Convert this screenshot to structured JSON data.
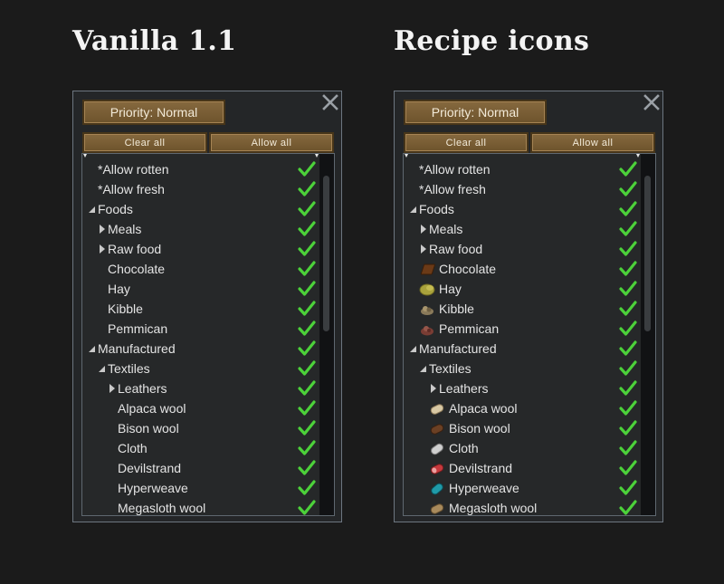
{
  "left": {
    "heading": "Vanilla 1.1",
    "priority_label": "Priority: Normal",
    "clear_all": "Clear all",
    "allow_all": "Allow all",
    "rows": [
      {
        "label": "*Allow rotten",
        "depth": 0,
        "arrow": "none",
        "icon": null
      },
      {
        "label": "*Allow fresh",
        "depth": 0,
        "arrow": "none",
        "icon": null
      },
      {
        "label": "Foods",
        "depth": 0,
        "arrow": "down",
        "icon": null
      },
      {
        "label": "Meals",
        "depth": 1,
        "arrow": "right",
        "icon": null
      },
      {
        "label": "Raw food",
        "depth": 1,
        "arrow": "right",
        "icon": null
      },
      {
        "label": "Chocolate",
        "depth": 1,
        "arrow": "none",
        "icon": null
      },
      {
        "label": "Hay",
        "depth": 1,
        "arrow": "none",
        "icon": null
      },
      {
        "label": "Kibble",
        "depth": 1,
        "arrow": "none",
        "icon": null
      },
      {
        "label": "Pemmican",
        "depth": 1,
        "arrow": "none",
        "icon": null
      },
      {
        "label": "Manufactured",
        "depth": 0,
        "arrow": "down",
        "icon": null
      },
      {
        "label": "Textiles",
        "depth": 1,
        "arrow": "down",
        "icon": null
      },
      {
        "label": "Leathers",
        "depth": 2,
        "arrow": "right",
        "icon": null
      },
      {
        "label": "Alpaca wool",
        "depth": 2,
        "arrow": "none",
        "icon": null
      },
      {
        "label": "Bison wool",
        "depth": 2,
        "arrow": "none",
        "icon": null
      },
      {
        "label": "Cloth",
        "depth": 2,
        "arrow": "none",
        "icon": null
      },
      {
        "label": "Devilstrand",
        "depth": 2,
        "arrow": "none",
        "icon": null
      },
      {
        "label": "Hyperweave",
        "depth": 2,
        "arrow": "none",
        "icon": null
      },
      {
        "label": "Megasloth wool",
        "depth": 2,
        "arrow": "none",
        "icon": null
      }
    ]
  },
  "right": {
    "heading": "Recipe icons",
    "priority_label": "Priority: Normal",
    "clear_all": "Clear all",
    "allow_all": "Allow all",
    "rows": [
      {
        "label": "*Allow rotten",
        "depth": 0,
        "arrow": "none",
        "icon": null
      },
      {
        "label": "*Allow fresh",
        "depth": 0,
        "arrow": "none",
        "icon": null
      },
      {
        "label": "Foods",
        "depth": 0,
        "arrow": "down",
        "icon": null
      },
      {
        "label": "Meals",
        "depth": 1,
        "arrow": "right",
        "icon": null
      },
      {
        "label": "Raw food",
        "depth": 1,
        "arrow": "right",
        "icon": null
      },
      {
        "label": "Chocolate",
        "depth": 1,
        "arrow": "none",
        "icon": "chocolate-icon"
      },
      {
        "label": "Hay",
        "depth": 1,
        "arrow": "none",
        "icon": "hay-icon"
      },
      {
        "label": "Kibble",
        "depth": 1,
        "arrow": "none",
        "icon": "kibble-icon"
      },
      {
        "label": "Pemmican",
        "depth": 1,
        "arrow": "none",
        "icon": "pemmican-icon"
      },
      {
        "label": "Manufactured",
        "depth": 0,
        "arrow": "down",
        "icon": null
      },
      {
        "label": "Textiles",
        "depth": 1,
        "arrow": "down",
        "icon": null
      },
      {
        "label": "Leathers",
        "depth": 2,
        "arrow": "right",
        "icon": null
      },
      {
        "label": "Alpaca wool",
        "depth": 2,
        "arrow": "none",
        "icon": "alpaca-wool-icon"
      },
      {
        "label": "Bison wool",
        "depth": 2,
        "arrow": "none",
        "icon": "bison-wool-icon"
      },
      {
        "label": "Cloth",
        "depth": 2,
        "arrow": "none",
        "icon": "cloth-icon"
      },
      {
        "label": "Devilstrand",
        "depth": 2,
        "arrow": "none",
        "icon": "devilstrand-icon"
      },
      {
        "label": "Hyperweave",
        "depth": 2,
        "arrow": "none",
        "icon": "hyperweave-icon"
      },
      {
        "label": "Megasloth wool",
        "depth": 2,
        "arrow": "none",
        "icon": "megasloth-wool-icon"
      }
    ]
  },
  "colors": {
    "check": "#4cd13a",
    "button": "#7a5f36",
    "panel_border": "#6d7680"
  }
}
